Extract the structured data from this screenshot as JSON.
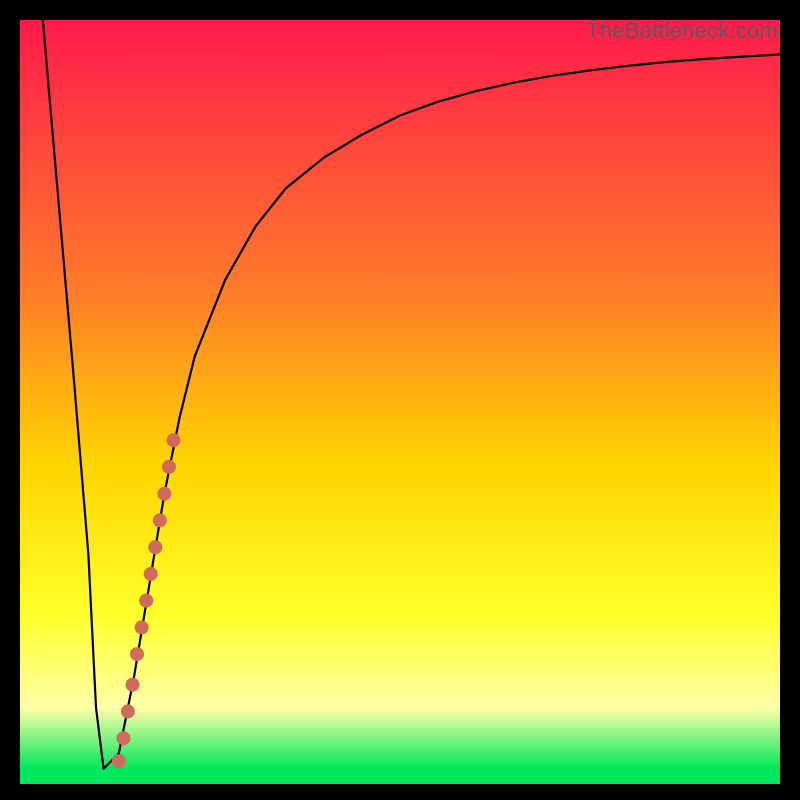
{
  "watermark": "TheBottleneck.com",
  "colors": {
    "frame": "#000000",
    "gradient_top": "#ff1a4b",
    "gradient_mid1": "#ff7a2a",
    "gradient_mid2": "#ffd400",
    "gradient_mid3": "#ffff2a",
    "gradient_pale": "#ffffa8",
    "gradient_bottom": "#00e85c",
    "curve": "#000000",
    "dots": "#cf6a5d"
  },
  "chart_data": {
    "type": "line",
    "title": "",
    "xlabel": "",
    "ylabel": "",
    "xlim": [
      0,
      100
    ],
    "ylim": [
      0,
      100
    ],
    "grid": false,
    "legend": false,
    "series": [
      {
        "name": "bottleneck-curve",
        "x": [
          3,
          5,
          7,
          9,
          10,
          11,
          13,
          15,
          17,
          19,
          21,
          23,
          27,
          31,
          35,
          40,
          45,
          50,
          55,
          60,
          65,
          70,
          75,
          80,
          85,
          90,
          95,
          100
        ],
        "y": [
          100,
          77,
          54,
          30,
          10,
          2,
          4,
          14,
          26,
          38,
          48,
          56,
          66,
          73,
          78,
          82,
          85,
          87.5,
          89.3,
          90.7,
          91.8,
          92.7,
          93.4,
          94,
          94.5,
          94.9,
          95.2,
          95.5
        ]
      },
      {
        "name": "highlight-dots",
        "x": [
          13.0,
          13.6,
          14.2,
          14.8,
          15.4,
          16.0,
          16.6,
          17.2,
          17.8,
          18.4,
          19.0,
          19.6,
          20.2
        ],
        "y": [
          3,
          6,
          9.5,
          13,
          17,
          20.5,
          24,
          27.5,
          31,
          34.5,
          38,
          41.5,
          45
        ]
      }
    ]
  }
}
